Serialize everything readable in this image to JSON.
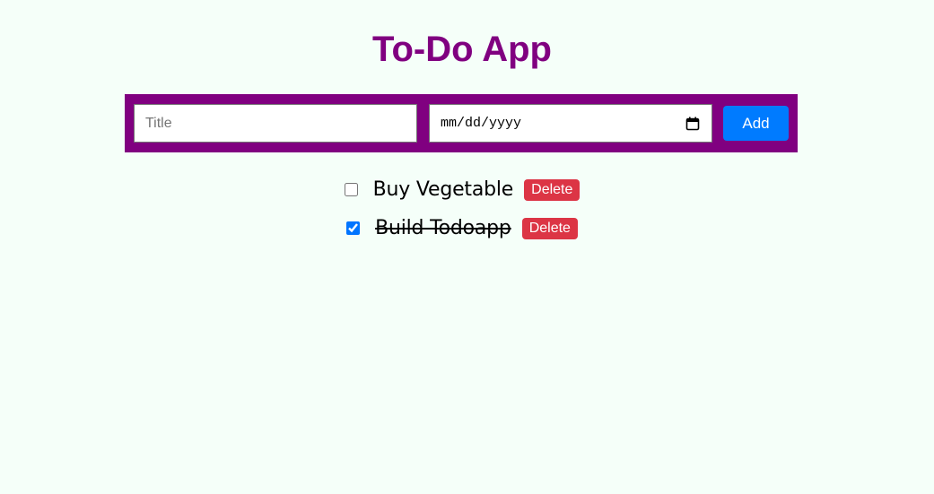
{
  "header": {
    "title": "To-Do App"
  },
  "form": {
    "title_placeholder": "Title",
    "title_value": "",
    "date_placeholder": "mm/dd/yyyy",
    "date_icon": "calendar-icon",
    "add_label": "Add"
  },
  "todos": [
    {
      "text": "Buy Vegetable",
      "completed": false,
      "delete_label": "Delete"
    },
    {
      "text": "Build Todoapp",
      "completed": true,
      "delete_label": "Delete"
    }
  ],
  "colors": {
    "background": "#f5fff9",
    "accent": "#800080",
    "add_button": "#007bff",
    "delete_button": "#dc3545"
  }
}
